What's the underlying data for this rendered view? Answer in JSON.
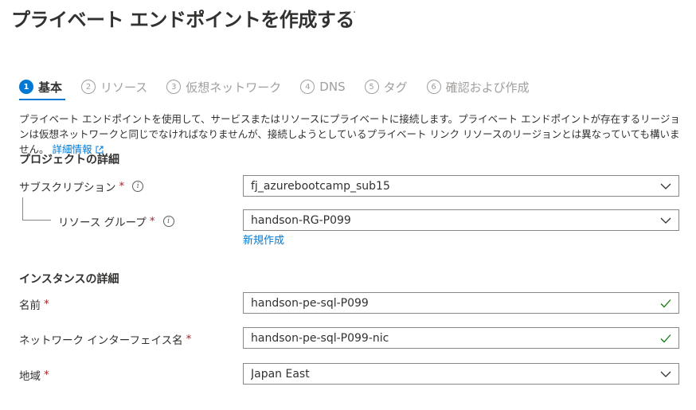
{
  "header": {
    "title": "プライベート エンドポイントを作成する",
    "more": "···"
  },
  "steps": [
    {
      "num": "1",
      "label": "基本"
    },
    {
      "num": "2",
      "label": "リソース"
    },
    {
      "num": "3",
      "label": "仮想ネットワーク"
    },
    {
      "num": "4",
      "label": "DNS"
    },
    {
      "num": "5",
      "label": "タグ"
    },
    {
      "num": "6",
      "label": "確認および作成"
    }
  ],
  "description": {
    "text": "プライベート エンドポイントを使用して、サービスまたはリソースにプライベートに接続します。プライベート エンドポイントが存在するリージョンは仮想ネットワークと同じでなければなりませんが、接続しようとしているプライベート リンク リソースのリージョンとは異なっていても構いません。",
    "link": "詳細情報"
  },
  "project": {
    "heading": "プロジェクトの詳細",
    "subscription": {
      "label": "サブスクリプション",
      "value": "fj_azurebootcamp_sub15"
    },
    "resource_group": {
      "label": "リソース グループ",
      "value": "handson-RG-P099",
      "create_link": "新規作成"
    }
  },
  "instance": {
    "heading": "インスタンスの詳細",
    "name": {
      "label": "名前",
      "value": "handson-pe-sql-P099"
    },
    "nic": {
      "label": "ネットワーク インターフェイス名",
      "value": "handson-pe-sql-P099-nic"
    },
    "region": {
      "label": "地域",
      "value": "Japan East"
    }
  },
  "common": {
    "required": "*",
    "info": "i"
  },
  "colors": {
    "accent": "#0078d4",
    "required": "#a4262c",
    "valid": "#107c10"
  }
}
